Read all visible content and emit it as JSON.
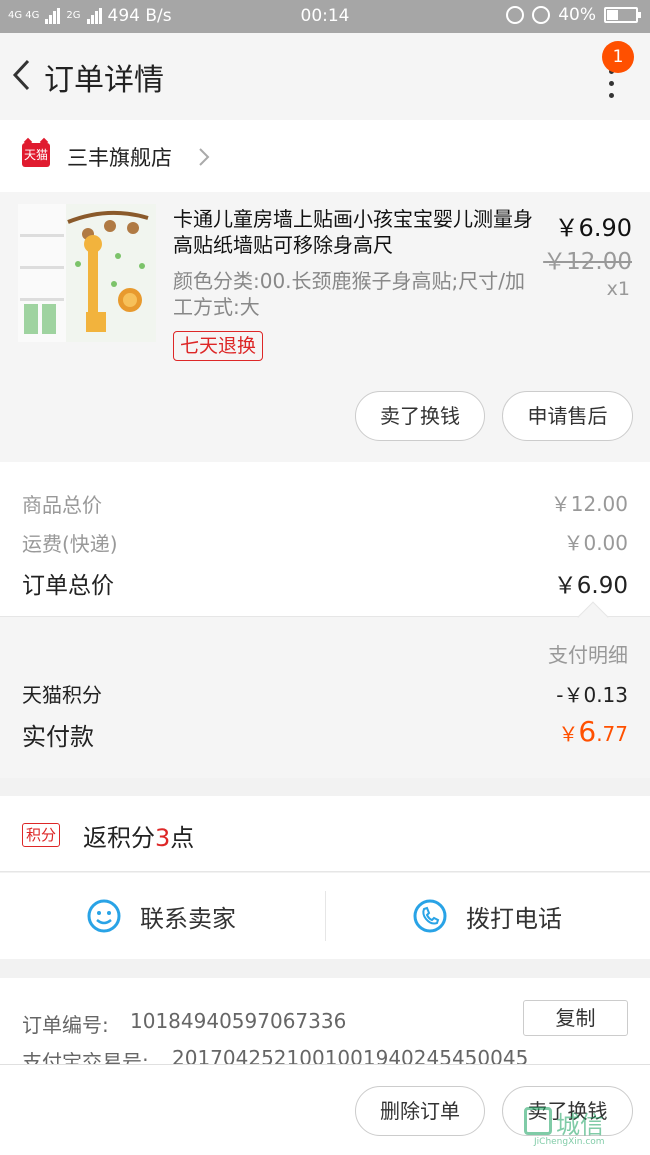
{
  "status_bar": {
    "network": "4G 4G",
    "network2": "2G",
    "speed": "494 B/s",
    "time": "00:14",
    "battery": "40%",
    "battery_level": 0.4
  },
  "header": {
    "title": "订单详情",
    "badge": "1"
  },
  "store": {
    "logo_text": "天猫",
    "name": "三丰旗舰店"
  },
  "item": {
    "title": "卡通儿童房墙上贴画小孩宝宝婴儿测量身高贴纸墙贴可移除身高尺",
    "sku": "颜色分类:00.长颈鹿猴子身高贴;尺寸/加工方式:大",
    "refund_tag": "七天退换",
    "price": "￥6.90",
    "original_price": "￥12.00",
    "quantity": "x1",
    "sell_button": "卖了换钱",
    "aftersale_button": "申请售后"
  },
  "totals": {
    "goods_label": "商品总价",
    "goods_value": "￥12.00",
    "shipping_label": "运费(快递)",
    "shipping_value": "￥0.00",
    "order_total_label": "订单总价",
    "order_total_value": "￥6.90"
  },
  "payment": {
    "detail_link": "支付明细",
    "points_label": "天猫积分",
    "points_value": "-￥0.13",
    "paid_label": "实付款",
    "paid_currency": "￥",
    "paid_int": "6",
    "paid_dec": ".77"
  },
  "points": {
    "tag": "积分",
    "text_prefix": "返积分",
    "number": "3",
    "text_suffix": "点"
  },
  "contact": {
    "seller_label": "联系卖家",
    "phone_label": "拨打电话"
  },
  "order_info": {
    "order_no_label": "订单编号:",
    "order_no": "10184940597067336",
    "copy_button": "复制",
    "alipay_label": "支付宝交易号:",
    "alipay_no": "2017042521001001940245450045"
  },
  "bottom_bar": {
    "delete_button": "删除订单",
    "sell_button": "卖了换钱"
  },
  "watermark": {
    "text": "城信",
    "sub": "JiChengXin.com"
  },
  "colors": {
    "accent": "#ff5000",
    "tmall_red": "#dd2727",
    "badge": "#ff5000",
    "contact_icon": "#29a3e6"
  }
}
